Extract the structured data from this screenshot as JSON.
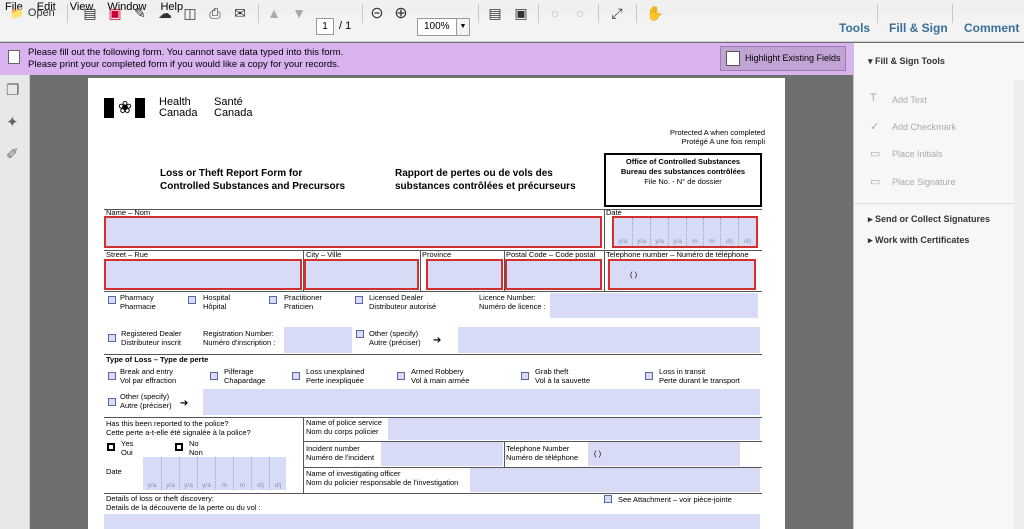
{
  "menu": [
    "File",
    "Edit",
    "View",
    "Window",
    "Help"
  ],
  "toolbar": {
    "open": "Open",
    "page_current": "1",
    "page_total": "/ 1",
    "zoom": "100%"
  },
  "right_tabs": {
    "tools": "Tools",
    "fill_sign": "Fill & Sign",
    "comment": "Comment"
  },
  "notice": {
    "line1": "Please fill out the following form. You cannot save data typed into this form.",
    "line2": "Please print your completed form if you would like a copy for your records.",
    "button": "Highlight Existing Fields"
  },
  "panel": {
    "heading": "Fill & Sign Tools",
    "items": [
      "Add Text",
      "Add Checkmark",
      "Place Initials",
      "Place Signature"
    ],
    "send": "Send or Collect Signatures",
    "certs": "Work with Certificates"
  },
  "form": {
    "logo_en": "Health",
    "logo_en2": "Canada",
    "logo_fr": "Santé",
    "logo_fr2": "Canada",
    "protected1": "Protected A when completed",
    "protected2": "Protégé A une fois rempli",
    "title_en1": "Loss or Theft Report Form for",
    "title_en2": "Controlled Substances and Precursors",
    "title_fr1": "Rapport de pertes ou de vols des",
    "title_fr2": "substances contrôlées et précurseurs",
    "office1": "Office of Controlled Substances",
    "office2": "Bureau des substances contrôlées",
    "office3": "File No. - N° de dossier",
    "name": "Name – Nom",
    "date": "Date",
    "date_cells": [
      "y/a",
      "y/a",
      "y/a",
      "y/a",
      "m",
      "m",
      "d/j",
      "d/j"
    ],
    "street": "Street – Rue",
    "city": "City – Ville",
    "province": "Province",
    "postal": "Postal Code – Code postal",
    "phone": "Telephone number – Numéro de téléphone",
    "paren": "(          )",
    "pharmacy1": "Pharmacy",
    "pharmacy2": "Pharmacie",
    "hospital1": "Hospital",
    "hospital2": "Hôpital",
    "practitioner1": "Practitioner",
    "practitioner2": "Praticien",
    "dealer1": "Licensed Dealer",
    "dealer2": "Distributeur autorisé",
    "licence1": "Licence Number:",
    "licence2": "Numéro de licence :",
    "reg1": "Registered Dealer",
    "reg2": "Distributeur inscrit",
    "regno1": "Registration Number:",
    "regno2": "Numéro d'inscription :",
    "other1": "Other (specify)",
    "other2": "Autre (préciser)",
    "typeloss": "Type of Loss – Type de perte",
    "break1": "Break and entry",
    "break2": "Vol par effraction",
    "pilf1": "Pilferage",
    "pilf2": "Chapardage",
    "unexp1": "Loss unexplained",
    "unexp2": "Perte inexpliquée",
    "armed1": "Armed Robbery",
    "armed2": "Vol à main armée",
    "grab1": "Grab theft",
    "grab2": "Vol à la sauvette",
    "transit1": "Loss in transit",
    "transit2": "Perte durant le transport",
    "police_q1": "Has this been reported to the police?",
    "police_q2": "Cette perte a-t-elle été signalée à la police?",
    "yes1": "Yes",
    "yes2": "Oui",
    "no1": "No",
    "no2": "Non",
    "date2": "Date",
    "service1": "Name of police service",
    "service2": "Nom du corps policier",
    "incident1": "Incident number",
    "incident2": "Numéro de l'incident",
    "tel1": "Telephone Number",
    "tel2": "Numéro de téléphone",
    "officer1": "Name of investigating officer",
    "officer2": "Nom du policier responsable de l'investigation",
    "details1": "Details of loss or theft discovery:",
    "details2": "Details de la découverte de la perte ou du vol :",
    "attach": "See Attachment – voir pièce-jointe"
  }
}
